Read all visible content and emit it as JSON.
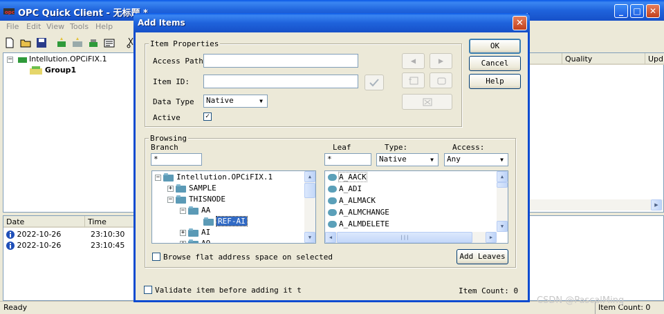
{
  "main": {
    "title": "OPC Quick Client - 无标题 *",
    "menu": [
      "File",
      "Edit",
      "View",
      "Tools",
      "Help"
    ],
    "tree": {
      "server": "Intellution.OPCiFIX.1",
      "group": "Group1"
    },
    "columns": {
      "quality": "Quality",
      "update": "Upd"
    },
    "log": {
      "headers": [
        "Date",
        "Time"
      ],
      "rows": [
        {
          "date": "2022-10-26",
          "time": "23:10:30"
        },
        {
          "date": "2022-10-26",
          "time": "23:10:45"
        }
      ]
    },
    "status": {
      "left": "Ready",
      "right": "Item Count: 0"
    }
  },
  "dialog": {
    "title": "Add Items",
    "item_properties": {
      "legend": "Item Properties",
      "access_path_label": "Access Path",
      "access_path_value": "",
      "item_id_label": "Item ID:",
      "item_id_value": "",
      "data_type_label": "Data Type",
      "data_type_value": "Native",
      "active_label": "Active",
      "active_checked": true
    },
    "buttons": {
      "ok": "OK",
      "cancel": "Cancel",
      "help": "Help",
      "add_leaves": "Add Leaves"
    },
    "browsing": {
      "legend": "Browsing",
      "branch_label": "Branch",
      "branch_filter": "*",
      "leaf_label": "Leaf",
      "leaf_filter": "*",
      "type_label": "Type:",
      "type_value": "Native",
      "access_label": "Access:",
      "access_value": "Any",
      "tree": [
        "Intellution.OPCiFIX.1",
        "SAMPLE",
        "THISNODE",
        "AA",
        "REF-AI",
        "AI",
        "AO"
      ],
      "leaves": [
        "A_AACK",
        "A_ADI",
        "A_ALMACK",
        "A_ALMCHANGE",
        "A_ALMDELETE"
      ],
      "browse_flat_label": "Browse flat address space on selected"
    },
    "validate_label": "Validate item before adding it t",
    "item_count": "Item Count: 0"
  },
  "watermark": "CSDN @PascalMing",
  "colors": {
    "titlebar": "#1f63dc",
    "selection": "#316ac5",
    "face": "#ece9d8"
  }
}
